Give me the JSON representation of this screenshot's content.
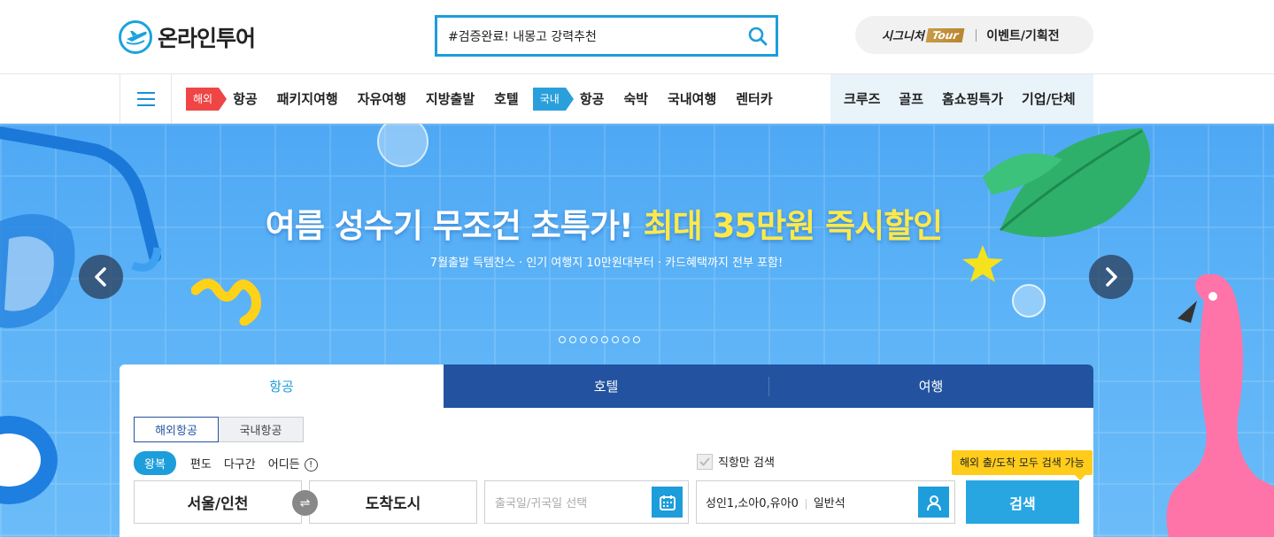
{
  "header": {
    "logo_text": "온라인투어",
    "search": {
      "value": "#검증완료! 내몽고 강력추천"
    },
    "signature": {
      "text": "시그니처",
      "badge": "Tour"
    },
    "event_link": "이벤트/기획전"
  },
  "nav": {
    "overseas_tag": "해외",
    "overseas_items": [
      "항공",
      "패키지여행",
      "자유여행",
      "지방출발",
      "호텔"
    ],
    "domestic_tag": "국내",
    "domestic_items": [
      "항공",
      "숙박",
      "국내여행",
      "렌터카"
    ],
    "right_items": [
      "크루즈",
      "골프",
      "홈쇼핑특가",
      "기업/단체"
    ]
  },
  "hero": {
    "title_main": "여름 성수기 무조건 초특가!",
    "title_highlight": "최대 35만원 즉시할인",
    "subtitle": "7월출발 득템찬스 · 인기 여행지 10만원대부터 · 카드혜택까지 전부 포함!",
    "slide_count": 8,
    "colors": {
      "sky": "#5cb3f7",
      "highlight": "#ffe94a"
    }
  },
  "panel": {
    "tabs": [
      "항공",
      "호텔",
      "여행"
    ],
    "segments": [
      "해외항공",
      "국내항공"
    ],
    "trip_types": [
      "왕복",
      "편도",
      "다구간",
      "어디든"
    ],
    "direct_only": "직항만 검색",
    "tooltip": "해외 출/도착 모두 검색 가능",
    "departure": "서울/인천",
    "arrival": "도착도시",
    "date_placeholder": "출국일/귀국일 선택",
    "passengers": "성인1,소아0,유아0",
    "cabin": "일반석",
    "search_button": "검색",
    "accent": "#1e9ddb",
    "tab_dark": "#2353a0"
  }
}
